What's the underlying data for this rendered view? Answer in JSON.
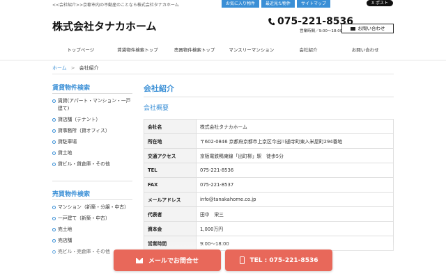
{
  "topbar": {
    "tagline": "<<会社紹介>>京都市内の不動産のことなら株式会社タナカホーム",
    "links": [
      "お気に入り物件",
      "最近見た物件",
      "サイトマップ"
    ],
    "x_post": "X ポスト"
  },
  "header": {
    "logo": "株式会社タナカホーム",
    "phone": "075-221-8536",
    "hours": "営業時間／9:00～18:00",
    "contact_button": "お問い合わせ"
  },
  "nav": [
    "トップページ",
    "賃貸物件検索トップ",
    "売買物件検索トップ",
    "マンスリーマンション",
    "会社紹介",
    "お問い合わせ"
  ],
  "breadcrumb": {
    "home": "ホーム",
    "sep": ">",
    "current": "会社紹介"
  },
  "sidebar": {
    "rent_heading": "賃貸物件検索",
    "rent_items": [
      "賃貸(アパート・マンション・一戸建て)",
      "貸店舗（テナント）",
      "貸事務所（貸オフィス）",
      "貸駐車場",
      "貸土地",
      "貸ビル・貸倉庫・その他"
    ],
    "sale_heading": "売買物件検索",
    "sale_items": [
      "マンション（新築・分譲・中古）",
      "一戸建て（新築・中古）",
      "売土地",
      "売店舗",
      "売ビル・売倉庫・その他"
    ]
  },
  "main": {
    "title": "会社紹介",
    "subtitle": "会社概要",
    "rows": [
      {
        "k": "会社名",
        "v": "株式会社タナカホーム"
      },
      {
        "k": "所在地",
        "v": "〒602-0846 京都府京都市上京区今出川通寺町東入米屋町294番地"
      },
      {
        "k": "交通アクセス",
        "v": "京阪電鉄鴨東線「出町柳」駅　徒歩5分"
      },
      {
        "k": "TEL",
        "v": "075-221-8536"
      },
      {
        "k": "FAX",
        "v": "075-221-8537"
      },
      {
        "k": "メールアドレス",
        "v": "info@tanakahome.co.jp"
      },
      {
        "k": "代表者",
        "v": "田中　栄三"
      },
      {
        "k": "資本金",
        "v": "1,000万円"
      },
      {
        "k": "営業時間",
        "v": "9:00～18:00"
      }
    ]
  },
  "cta": {
    "mail": "メールでお問合せ",
    "tel": "TEL : 075-221-8536"
  },
  "colors": {
    "accent": "#3a8fd6",
    "cta": "#e8685a"
  }
}
